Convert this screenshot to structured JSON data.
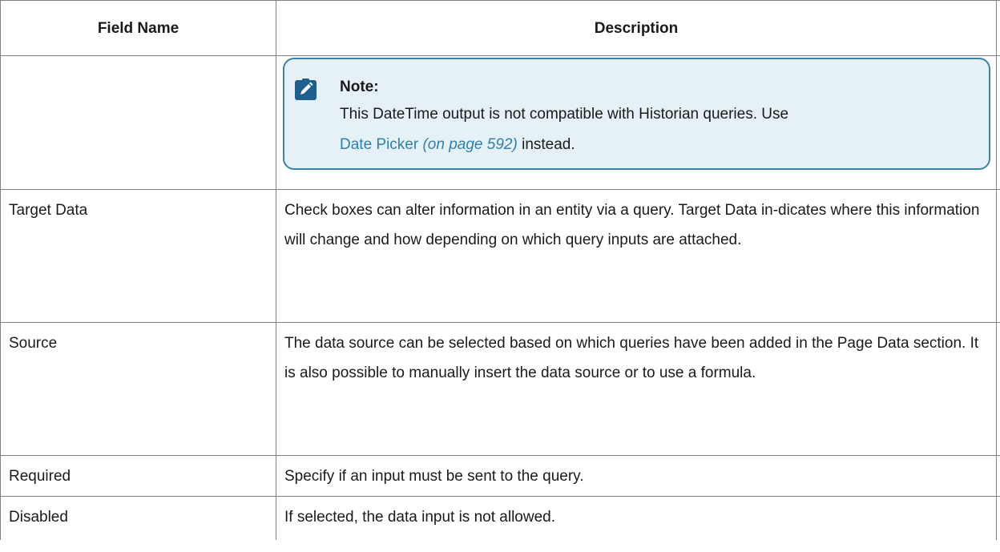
{
  "table": {
    "headers": {
      "field_name": "Field Name",
      "description": "Description"
    },
    "note": {
      "title": "Note:",
      "text_before": "This DateTime output is not compatible with Historian queries. Use",
      "link_text": "Date Picker",
      "link_ref": "(on page 592)",
      "text_after": "instead."
    },
    "rows": [
      {
        "field": "Target Data",
        "description": "Check boxes can alter information in an entity via a query. Target Data in-dicates where this information will change and how depending on which query inputs are attached."
      },
      {
        "field": "Source",
        "description": "The data source can be selected based on which queries have been added in the Page Data section. It is also possible to manually insert the data source or to use a formula."
      },
      {
        "field": "Required",
        "description": "Specify if an input must be sent to the query."
      },
      {
        "field": "Disabled",
        "description": "If selected, the data input is not allowed."
      }
    ],
    "icon": "note-pencil-icon",
    "colors": {
      "note_background": "#e5f1f6",
      "note_border": "#3a82a8",
      "link": "#2f80ad",
      "icon": "#1f5f8b"
    }
  }
}
